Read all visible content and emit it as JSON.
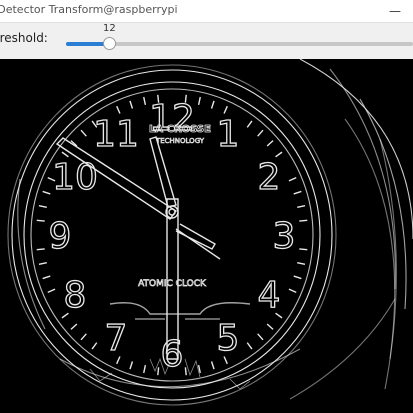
{
  "window": {
    "title": "ge Detector Transform@raspberrypi",
    "minimize_glyph": "—"
  },
  "controls": {
    "threshold_label": "hreshold:",
    "threshold_value": "12",
    "threshold_fraction": 0.12
  },
  "image": {
    "description_icon": "edge-detected-clock-image",
    "numerals": [
      "12",
      "1",
      "2",
      "3",
      "4",
      "5",
      "6",
      "7",
      "8",
      "9",
      "10",
      "11"
    ],
    "brand_top": "LA CROSSE",
    "brand_sub": "TECHNOLOGY",
    "brand_bottom": "ATOMIC CLOCK",
    "edge_color": "#e8e8e8",
    "background_color": "#000000"
  }
}
